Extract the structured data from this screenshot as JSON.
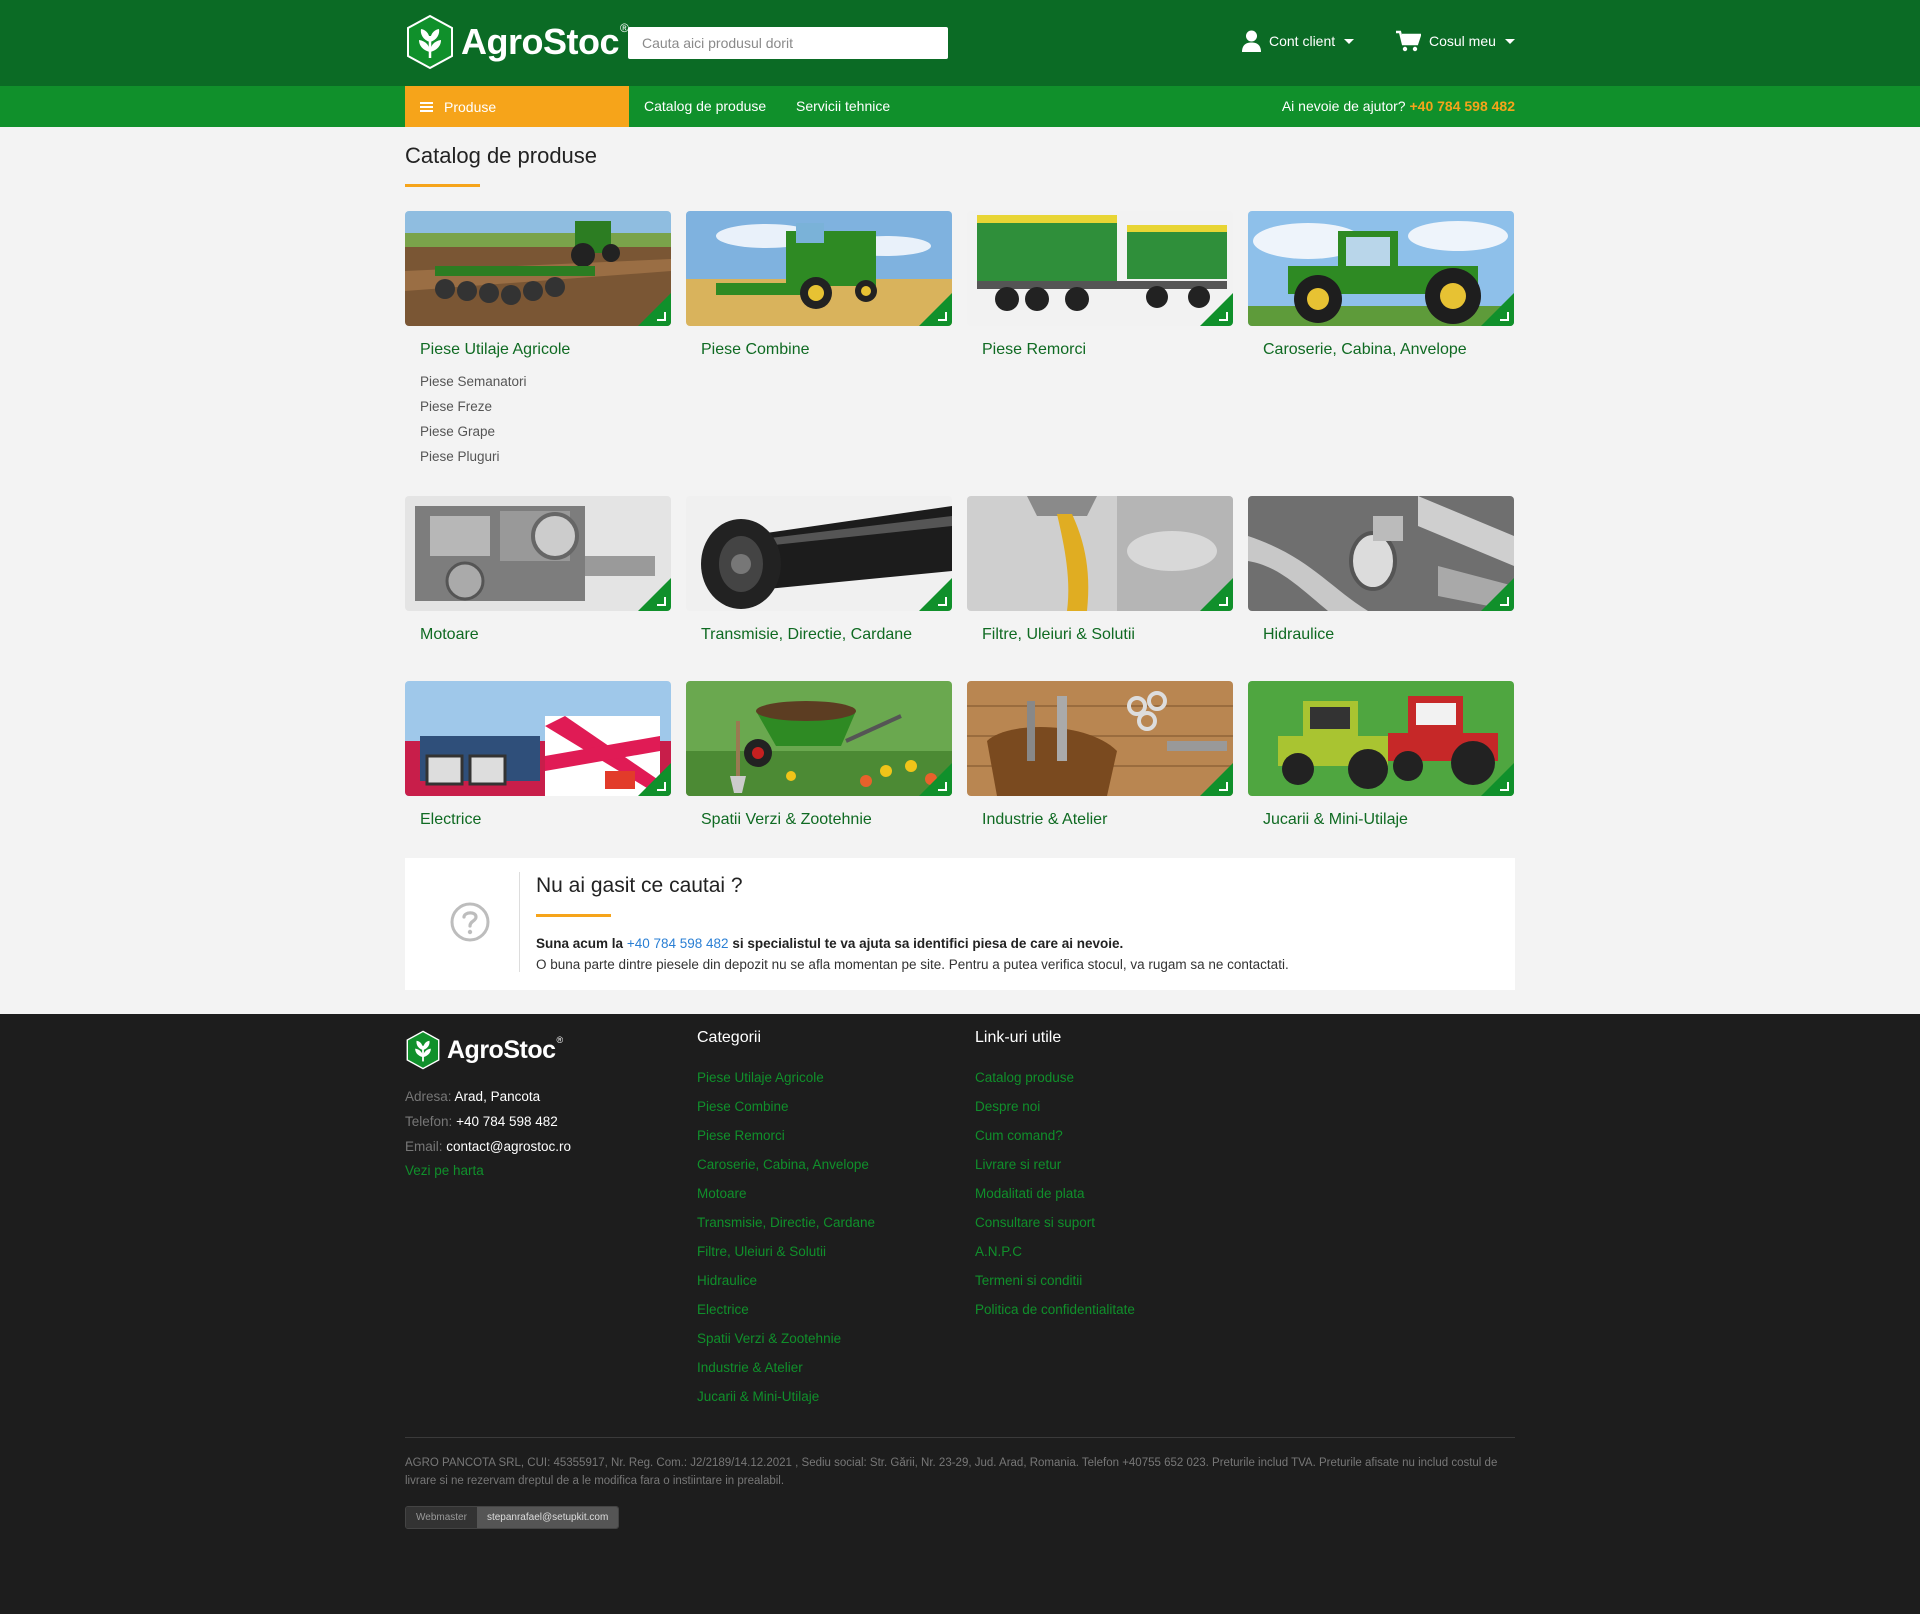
{
  "header": {
    "logo_text": "AgroStoc",
    "logo_reg": "®",
    "search_placeholder": "Cauta aici produsul dorit",
    "account_label": "Cont client",
    "cart_label": "Cosul meu"
  },
  "nav": {
    "produse": "Produse",
    "catalog": "Catalog de produse",
    "servicii": "Servicii tehnice",
    "help_text": "Ai nevoie de ajutor?",
    "help_phone": "+40 784 598 482"
  },
  "main": {
    "title": "Catalog de produse",
    "categories": [
      {
        "title": "Piese Utilaje Agricole",
        "sub": [
          "Piese Semanatori",
          "Piese Freze",
          "Piese Grape",
          "Piese Pluguri"
        ]
      },
      {
        "title": "Piese Combine"
      },
      {
        "title": "Piese Remorci"
      },
      {
        "title": "Caroserie, Cabina, Anvelope"
      },
      {
        "title": "Motoare"
      },
      {
        "title": "Transmisie, Directie, Cardane"
      },
      {
        "title": "Filtre, Uleiuri & Solutii"
      },
      {
        "title": "Hidraulice"
      },
      {
        "title": "Electrice"
      },
      {
        "title": "Spatii Verzi & Zootehnie"
      },
      {
        "title": "Industrie & Atelier"
      },
      {
        "title": "Jucarii & Mini-Utilaje"
      }
    ]
  },
  "helpbox": {
    "title": "Nu ai gasit ce cautai ?",
    "line1_pre": "Suna acum la",
    "line1_phone": "+40 784 598 482",
    "line1_post": "si specialistul te va ajuta sa identifici piesa de care ai nevoie.",
    "line2": "O buna parte dintre piesele din depozit nu se afla momentan pe site. Pentru a putea verifica stocul, va rugam sa ne contactati."
  },
  "footer": {
    "logo_text": "AgroStoc",
    "logo_reg": "®",
    "address_label": "Adresa:",
    "address_value": "Arad, Pancota",
    "phone_label": "Telefon:",
    "phone_value": "+40 784 598 482",
    "email_label": "Email:",
    "email_value": "contact@agrostoc.ro",
    "map_link": "Vezi pe harta",
    "categories_heading": "Categorii",
    "categories": [
      "Piese Utilaje Agricole",
      "Piese Combine",
      "Piese Remorci",
      "Caroserie, Cabina, Anvelope",
      "Motoare",
      "Transmisie, Directie, Cardane",
      "Filtre, Uleiuri & Solutii",
      "Hidraulice",
      "Electrice",
      "Spatii Verzi & Zootehnie",
      "Industrie & Atelier",
      "Jucarii & Mini-Utilaje"
    ],
    "links_heading": "Link-uri utile",
    "links": [
      "Catalog produse",
      "Despre noi",
      "Cum comand?",
      "Livrare si retur",
      "Modalitati de plata",
      "Consultare si suport",
      "A.N.P.C",
      "Termeni si conditii",
      "Politica de confidentialitate"
    ],
    "legal": "AGRO PANCOTA SRL, CUI: 45355917, Nr. Reg. Com.: J2/2189/14.12.2021 , Sediu social: Str. Gării, Nr. 23-29, Jud. Arad, Romania. Telefon +40755 652 023. Preturile includ TVA. Preturile afisate nu includ costul de livrare si ne rezervam dreptul de a le modifica fara o instiintare in prealabil.",
    "webmaster_label": "Webmaster",
    "webmaster_email": "stepanrafael@setupkit.com"
  },
  "colors": {
    "header_green": "#0b6b25",
    "nav_green": "#10902b",
    "accent_orange": "#f6a41a",
    "footer_bg": "#1d1d1d"
  }
}
